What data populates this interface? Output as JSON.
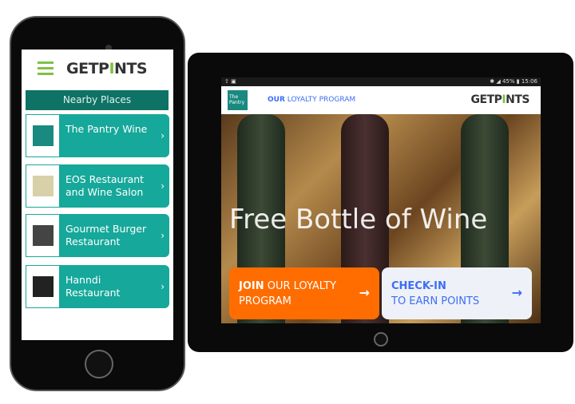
{
  "phone": {
    "brand": {
      "pre": "GETP",
      "mark": "I",
      "post": "NTS"
    },
    "section_title": "Nearby Places",
    "places": [
      {
        "name": "The Pantry Wine",
        "thumb": "#1a8a80"
      },
      {
        "name": "EOS Restaurant and Wine Salon",
        "thumb": "#d8d0a8"
      },
      {
        "name": "Gourmet Burger Restaurant",
        "thumb": "#444"
      },
      {
        "name": "Hanndi Restaurant",
        "thumb": "#222"
      }
    ]
  },
  "tablet": {
    "status_left": "⇧ ▣",
    "status_right": "✱ ◢ 45% ▮ 15:06",
    "header_link": {
      "bold": "OUR",
      "rest": " LOYALTY PROGRAM"
    },
    "brand": {
      "pre": "GETP",
      "mark": "I",
      "post": "NTS"
    },
    "pantry_logo": "The Pantry",
    "hero_title": "Free Bottle of Wine",
    "join_button": {
      "bold": "JOIN",
      "rest": " OUR LOYALTY",
      "line2": "PROGRAM"
    },
    "checkin_button": {
      "line1": "CHECK-IN",
      "line2": "TO EARN POINTS"
    }
  },
  "colors": {
    "teal": "#16a89a",
    "dark_teal": "#0e7265",
    "green": "#7cc242",
    "orange": "#ff6d00",
    "blue": "#3d6ef5"
  }
}
